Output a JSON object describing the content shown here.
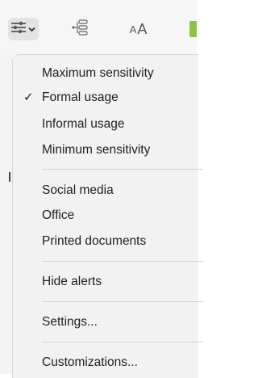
{
  "toolbar": {
    "font_button_large": "A",
    "font_button_small": "A"
  },
  "menu": {
    "items": [
      {
        "label": "Maximum sensitivity",
        "checked": false
      },
      {
        "label": "Formal usage",
        "checked": true
      },
      {
        "label": "Informal usage",
        "checked": false
      },
      {
        "label": "Minimum sensitivity",
        "checked": false
      },
      {
        "label": "Social media",
        "checked": false
      },
      {
        "label": "Office",
        "checked": false
      },
      {
        "label": "Printed documents",
        "checked": false
      },
      {
        "label": "Hide alerts",
        "checked": false
      },
      {
        "label": "Settings...",
        "checked": false
      },
      {
        "label": "Customizations...",
        "checked": false
      }
    ],
    "check_glyph": "✓"
  },
  "colors": {
    "accent_green": "#8bc34a",
    "menu_background": "#f2f2f2"
  }
}
